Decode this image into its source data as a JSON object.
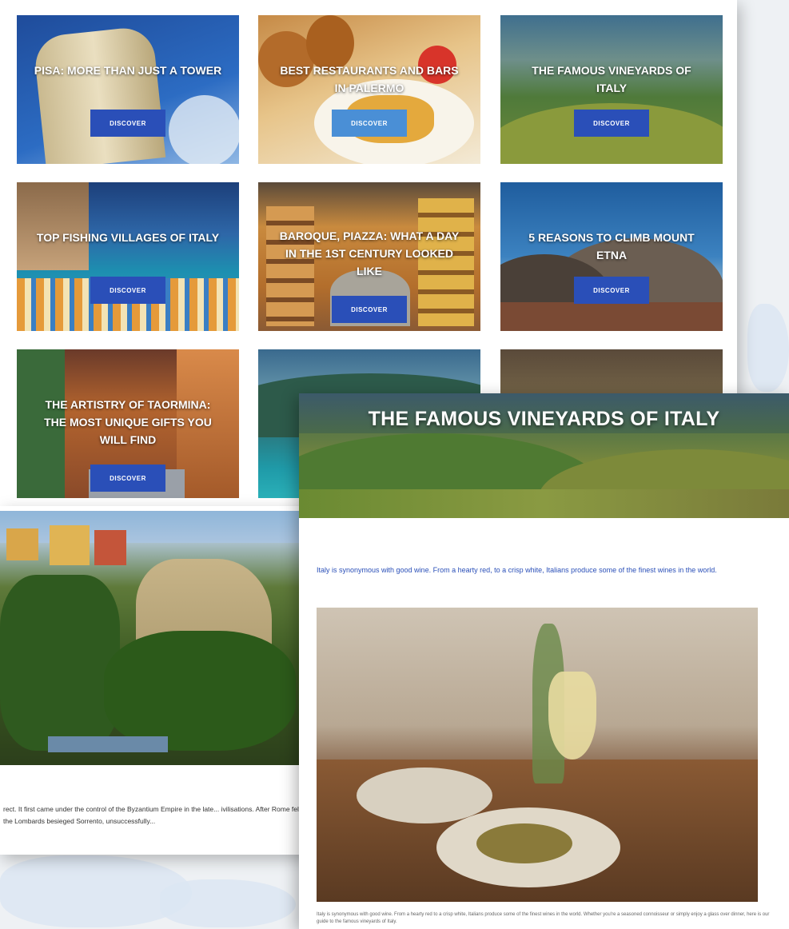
{
  "cards": [
    {
      "title": "Pisa: More Than Just a Tower",
      "button": "DISCOVER"
    },
    {
      "title": "Best Restaurants and Bars in Palermo",
      "button": "DISCOVER"
    },
    {
      "title": "The Famous Vineyards of Italy",
      "button": "DISCOVER"
    },
    {
      "title": "Top Fishing Villages of Italy",
      "button": "DISCOVER"
    },
    {
      "title": "Baroque, Piazza: What a Day in the 1st Century Looked Like",
      "button": "DISCOVER"
    },
    {
      "title": "5 Reasons to Climb Mount Etna",
      "button": "DISCOVER"
    },
    {
      "title": "The Artistry of Taormina: The Most Unique Gifts You Will Find",
      "button": "DISCOVER"
    },
    {
      "title": "",
      "button": ""
    },
    {
      "title": "",
      "button": ""
    }
  ],
  "sorrento_article": {
    "body": "rect. It first came under the control of the Byzantium Empire in the late... ivilisations. After Rome fell, the Lombards besieged Sorrento, unsuccessfully..."
  },
  "vineyards_article": {
    "title": "THE FAMOUS VINEYARDS OF ITALY",
    "intro": "Italy is synonymous with good wine. From a hearty red, to a crisp white, Italians produce some of the finest wines in the world.",
    "caption": "Italy is synonymous with good wine. From a hearty red to a crisp white, Italians produce some of the finest wines in the world. Whether you're a seasoned connoisseur or simply enjoy a glass over dinner, here is our guide to the famous vineyards of Italy."
  }
}
